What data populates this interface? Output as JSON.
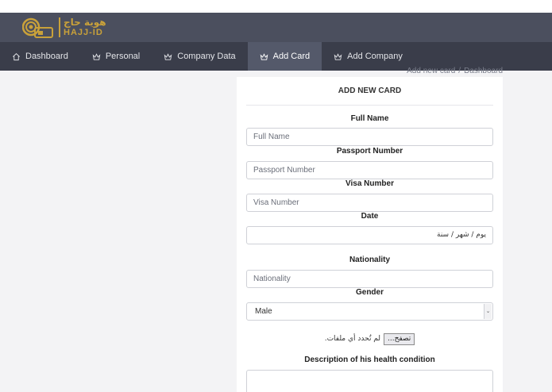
{
  "brand": {
    "arabic": "هوية حاج",
    "english": "HAJJ-ID",
    "color": "#c9a13a"
  },
  "nav": {
    "items": [
      {
        "label": "Dashboard",
        "icon": "home-icon"
      },
      {
        "label": "Personal",
        "icon": "crown-icon"
      },
      {
        "label": "Company Data",
        "icon": "crown-icon"
      },
      {
        "label": "Add Card",
        "icon": "crown-icon",
        "active": true
      },
      {
        "label": "Add Company",
        "icon": "crown-icon"
      }
    ]
  },
  "breadcrumb": {
    "current": "Add new card",
    "separator": "/",
    "parent": "Dashboard"
  },
  "form": {
    "title": "ADD NEW CARD",
    "full_name": {
      "label": "Full Name",
      "placeholder": "Full Name"
    },
    "passport": {
      "label": "Passport Number",
      "placeholder": "Passport Number"
    },
    "visa": {
      "label": "Visa Number",
      "placeholder": "Visa Number"
    },
    "date": {
      "label": "Date",
      "value": "يوم / شهر / سنة"
    },
    "nationality": {
      "label": "Nationality",
      "placeholder": "Nationality"
    },
    "gender": {
      "label": "Gender",
      "selected": "Male"
    },
    "file": {
      "button": "تصفح...",
      "status": "لم تُحدد أي ملفات."
    },
    "health": {
      "label": "Description of his health condition"
    }
  }
}
